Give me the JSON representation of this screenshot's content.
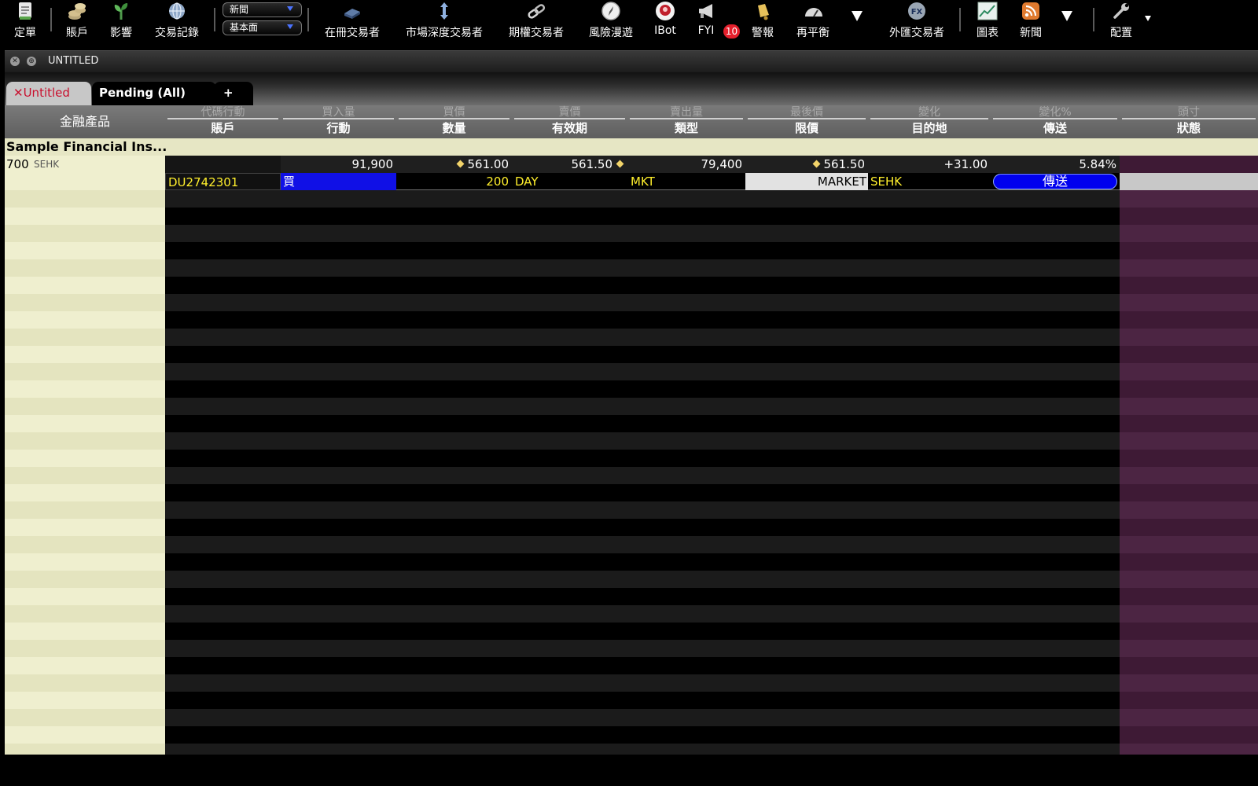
{
  "toolbar": {
    "order_entry": "定單",
    "account": "賬戶",
    "impact": "影響",
    "trade_log": "交易記錄",
    "select_news": "新聞",
    "select_fundamentals": "基本面",
    "book_trader": "在冊交易者",
    "depth_trader": "市場深度交易者",
    "option_trader": "期權交易者",
    "risk_navigator": "風險漫遊",
    "ibot": "IBot",
    "fyi": "FYI",
    "fyi_count": "10",
    "alerts": "警報",
    "rebalance": "再平衡",
    "fx_trader": "外匯交易者",
    "charts": "圖表",
    "news": "新聞",
    "configure": "配置",
    "fx_icon_text": "FX"
  },
  "window": {
    "title": "UNTITLED"
  },
  "tabs": {
    "untitled_x": "✕",
    "untitled": "Untitled",
    "pending": "Pending (All)",
    "add": "+"
  },
  "grid": {
    "header_product": "金融產品",
    "columns": [
      {
        "top": "代碼行動",
        "bottom": "賬戶"
      },
      {
        "top": "買入量",
        "bottom": "行動"
      },
      {
        "top": "買價",
        "bottom": "數量"
      },
      {
        "top": "賣價",
        "bottom": "有效期"
      },
      {
        "top": "賣出量",
        "bottom": "類型"
      },
      {
        "top": "最後價",
        "bottom": "限價"
      },
      {
        "top": "變化",
        "bottom": "目的地"
      },
      {
        "top": "變化%",
        "bottom": "傳送"
      },
      {
        "top": "頭寸",
        "bottom": "狀態"
      }
    ],
    "group_label": "Sample Financial Ins...",
    "quote": {
      "symbol": "700",
      "exchange": "SEHK",
      "bid_size": "91,900",
      "bid": "561.00",
      "ask": "561.50",
      "ask_size": "79,400",
      "last": "561.50",
      "change": "+31.00",
      "change_pct": "5.84%"
    },
    "order": {
      "account": "DU2742301",
      "action": "買",
      "quantity": "200",
      "tif": "DAY",
      "type": "MKT",
      "limit": "MARKET",
      "destination": "SEHK",
      "transmit": "傳送"
    }
  },
  "colors": {
    "action_blue": "#1010e6",
    "order_text_yellow": "#ffef2c",
    "fyi_badge_red": "#e41f2c",
    "tab_red": "#c8102e",
    "left_column_cream": "#efefcf",
    "right_column_plum": "#4c2543"
  }
}
